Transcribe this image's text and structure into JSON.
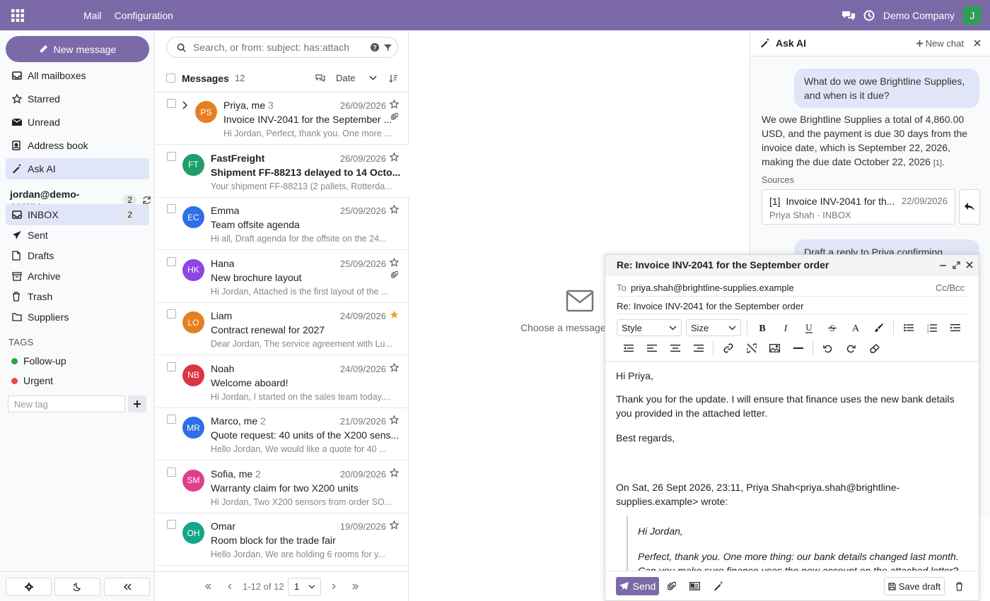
{
  "topbar": {
    "menus": [
      "Mail",
      "Configuration"
    ],
    "company": "Demo Company",
    "avatar_initial": "J"
  },
  "sidebar": {
    "new_message": "New message",
    "items": [
      {
        "label": "All mailboxes",
        "icon": "inbox-stack-icon"
      },
      {
        "label": "Starred",
        "icon": "star-icon"
      },
      {
        "label": "Unread",
        "icon": "envelope-icon"
      },
      {
        "label": "Address book",
        "icon": "address-book-icon"
      },
      {
        "label": "Ask AI",
        "icon": "magic-wand-icon"
      }
    ],
    "account": {
      "email": "jordan@demo-compa...",
      "count": "2"
    },
    "folders": [
      {
        "label": "INBOX",
        "count": "2"
      },
      {
        "label": "Sent"
      },
      {
        "label": "Drafts"
      },
      {
        "label": "Archive"
      },
      {
        "label": "Trash"
      },
      {
        "label": "Suppliers"
      }
    ],
    "tags_heading": "TAGS",
    "tags": [
      {
        "label": "Follow-up",
        "color": "#28a745"
      },
      {
        "label": "Urgent",
        "color": "#e74c3c"
      }
    ],
    "new_tag_placeholder": "New tag"
  },
  "list": {
    "search_placeholder": "Search, or from: subject: has:attachm",
    "title": "Messages",
    "count": "12",
    "sort_label": "Date",
    "messages": [
      {
        "initials": "PS",
        "color": "#e67e22",
        "from": "Priya, me",
        "thread": "3",
        "date": "26/09/2026",
        "subject": "Invoice INV-2041 for the September ...",
        "preview": "Hi Jordan, Perfect, thank you. One more ...",
        "unread": false,
        "starred": false,
        "attachment": true,
        "expand": true
      },
      {
        "initials": "FT",
        "color": "#1e9e6b",
        "from": "FastFreight",
        "thread": "",
        "date": "26/09/2026",
        "subject": "Shipment FF-88213 delayed to 14 Octo...",
        "preview": "Your shipment FF-88213 (2 pallets, Rotterda...",
        "unread": true,
        "starred": false,
        "attachment": false
      },
      {
        "initials": "EC",
        "color": "#2e6ee6",
        "from": "Emma",
        "thread": "",
        "date": "25/09/2026",
        "subject": "Team offsite agenda",
        "preview": "Hi all, Draft agenda for the offsite on the 24...",
        "unread": false,
        "starred": false,
        "attachment": false
      },
      {
        "initials": "HK",
        "color": "#8e44e6",
        "from": "Hana",
        "thread": "",
        "date": "25/09/2026",
        "subject": "New brochure layout",
        "preview": "Hi Jordan, Attached is the first layout of the ...",
        "unread": false,
        "starred": false,
        "attachment": true
      },
      {
        "initials": "LO",
        "color": "#e67e22",
        "from": "Liam",
        "thread": "",
        "date": "24/09/2026",
        "subject": "Contract renewal for 2027",
        "preview": "Dear Jordan, The service agreement with Lu...",
        "unread": false,
        "starred": true,
        "attachment": false
      },
      {
        "initials": "NB",
        "color": "#dc3545",
        "from": "Noah",
        "thread": "",
        "date": "24/09/2026",
        "subject": "Welcome aboard!",
        "preview": "Hi Jordan, I started on the sales team today....",
        "unread": false,
        "starred": false,
        "attachment": false
      },
      {
        "initials": "MR",
        "color": "#2e6ee6",
        "from": "Marco, me",
        "thread": "2",
        "date": "21/09/2026",
        "subject": "Quote request: 40 units of the X200 sens...",
        "preview": "Hello Jordan, We would like a quote for 40 ...",
        "unread": false,
        "starred": false,
        "attachment": false
      },
      {
        "initials": "SM",
        "color": "#e03e8c",
        "from": "Sofia, me",
        "thread": "2",
        "date": "20/09/2026",
        "subject": "Warranty claim for two X200 units",
        "preview": "Hi Jordan, Two X200 sensors from order SO...",
        "unread": false,
        "starred": false,
        "attachment": false
      },
      {
        "initials": "OH",
        "color": "#17a589",
        "from": "Omar",
        "thread": "",
        "date": "19/09/2026",
        "subject": "Room block for the trade fair",
        "preview": "Hello Jordan, We are holding 6 rooms for y...",
        "unread": false,
        "starred": false,
        "attachment": false
      }
    ],
    "pager": {
      "range": "1-12 of 12",
      "page": "1"
    }
  },
  "center": {
    "empty_text": "Choose a message to"
  },
  "ai": {
    "title": "Ask AI",
    "new_chat": "New chat",
    "question": "What do we owe Brightline Supplies, and when is it due?",
    "answer": "We owe Brightline Supplies a total of 4,860.00 USD, and the payment is due 30 days from the invoice date, which is September 22, 2026, making the due date October 22, 2026",
    "answer_ref": "[1]",
    "answer_end": ".",
    "sources_label": "Sources",
    "source": {
      "ref": "[1]",
      "title": "Invoice INV-2041 for th...",
      "date": "22/09/2026",
      "meta": "Priya Shah · INBOX"
    },
    "question2": "Draft a reply to Priya confirming"
  },
  "composer": {
    "title": "Re: Invoice INV-2041 for the September order",
    "to_label": "To",
    "to_value": "priya.shah@brightline-supplies.example",
    "cc_label": "Cc/Bcc",
    "subject": "Re: Invoice INV-2041 for the September order",
    "style_label": "Style",
    "size_label": "Size",
    "body": {
      "greeting": "Hi Priya,",
      "para": "Thank you for the update. I will ensure that finance uses the new bank details you provided in the attached letter.",
      "closing": "Best regards,",
      "quote_header": "On Sat, 26 Sept 2026, 23:11, Priya Shah<priya.shah@brightline-supplies.example> wrote:",
      "quote_greeting": "Hi Jordan,",
      "quote_para": "Perfect, thank you. One more thing: our bank details changed last month. Can you make sure finance uses the new account on the attached letter?"
    },
    "send_label": "Send",
    "save_draft_label": "Save draft"
  }
}
